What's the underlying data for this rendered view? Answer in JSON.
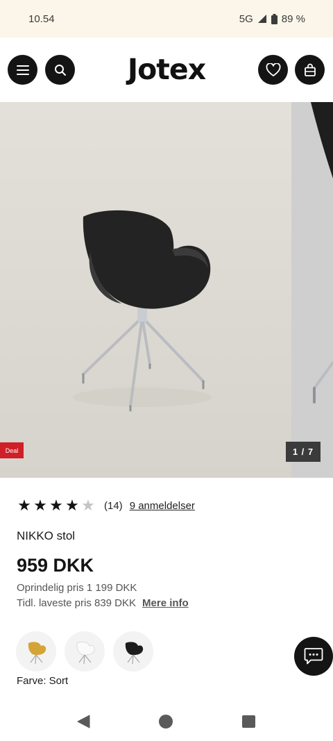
{
  "status_bar": {
    "time": "10.54",
    "network": "5G",
    "battery": "89 %"
  },
  "header": {
    "logo": "Jotex",
    "menu_icon": "hamburger-menu-icon",
    "search_icon": "search-icon",
    "wishlist_icon": "heart-icon",
    "cart_icon": "shopping-bag-icon"
  },
  "gallery": {
    "badge": "Deal",
    "counter": "1 / 7"
  },
  "product": {
    "rating": {
      "stars_filled": 4,
      "stars_total": 5,
      "count": "(14)",
      "reviews_link": "9 anmeldelser"
    },
    "name": "NIKKO stol",
    "price": "959 DKK",
    "original_price": "Oprindelig pris 1 199 DKK",
    "lowest_price": "Tidl. laveste pris 839 DKK",
    "more_info": "Mere info",
    "color_swatches": [
      {
        "color": "#d4a437"
      },
      {
        "color": "#f2f2f2"
      },
      {
        "color": "#1d1d1d"
      }
    ],
    "color_label": "Farve: Sort"
  },
  "chat_icon": "chat-bubble-icon",
  "nav": {
    "back_icon": "back-triangle-icon",
    "home_icon": "home-circle-icon",
    "recent_icon": "recent-apps-square-icon"
  }
}
